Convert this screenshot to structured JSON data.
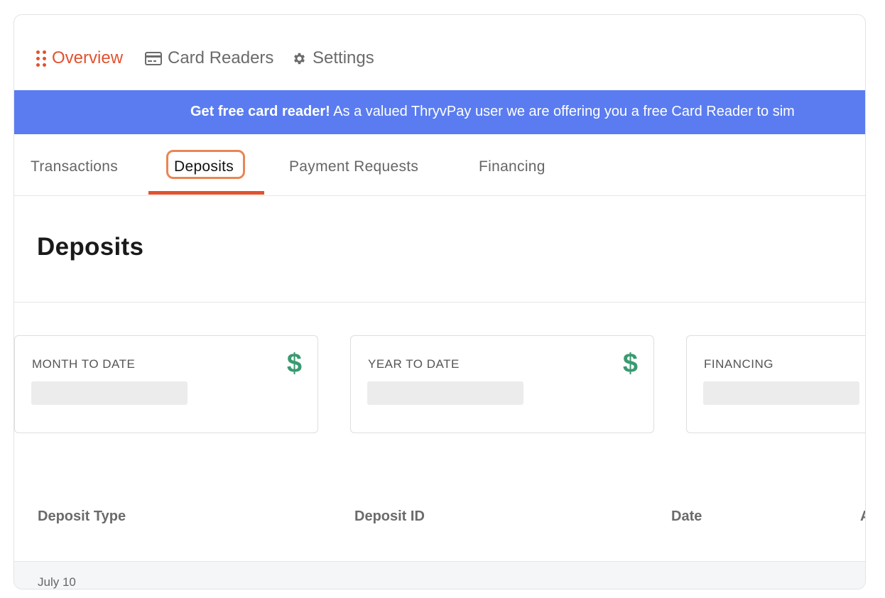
{
  "nav": {
    "overview": "Overview",
    "card_readers": "Card Readers",
    "settings": "Settings"
  },
  "banner": {
    "bold": "Get free card reader!",
    "text": " As a valued ThryvPay user we are offering you a free Card Reader to sim"
  },
  "tabs": {
    "transactions": "Transactions",
    "deposits": "Deposits",
    "payment_requests": "Payment Requests",
    "financing": "Financing"
  },
  "page_title": "Deposits",
  "stats": {
    "month": {
      "label": "MONTH TO DATE",
      "icon": "$"
    },
    "year": {
      "label": "YEAR TO DATE",
      "icon": "$"
    },
    "financing": {
      "label": "FINANCING"
    }
  },
  "table": {
    "headers": [
      "Deposit Type",
      "Deposit ID",
      "Date",
      "A"
    ],
    "group_label": "July 10"
  },
  "colors": {
    "accent": "#e1522f",
    "banner": "#5a7cf0",
    "dollar": "#3a9a72"
  }
}
